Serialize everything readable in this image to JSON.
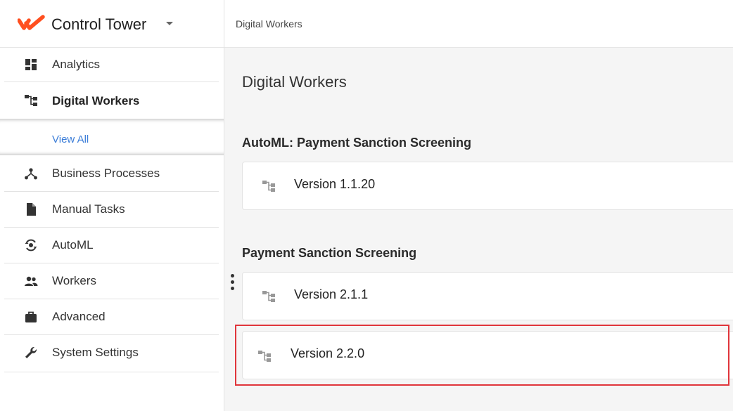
{
  "app": {
    "title": "Control Tower"
  },
  "breadcrumb": {
    "current": "Digital Workers"
  },
  "sidebar": {
    "items": [
      {
        "label": "Analytics",
        "icon": "dashboard-icon"
      },
      {
        "label": "Digital Workers",
        "icon": "hierarchy-icon",
        "active": true
      },
      {
        "label": "Business Processes",
        "icon": "process-icon"
      },
      {
        "label": "Manual Tasks",
        "icon": "document-icon"
      },
      {
        "label": "AutoML",
        "icon": "automl-icon"
      },
      {
        "label": "Workers",
        "icon": "people-icon"
      },
      {
        "label": "Advanced",
        "icon": "briefcase-icon"
      },
      {
        "label": "System Settings",
        "icon": "wrench-icon"
      }
    ],
    "subnav": {
      "view_all": "View All"
    }
  },
  "main": {
    "page_title": "Digital Workers",
    "groups": [
      {
        "title": "AutoML: Payment Sanction Screening",
        "versions": [
          "Version 1.1.20"
        ]
      },
      {
        "title": "Payment Sanction Screening",
        "versions": [
          "Version 2.1.1",
          "Version 2.2.0"
        ]
      }
    ]
  },
  "colors": {
    "brand": "#ff4f1f",
    "link": "#3b7dd8",
    "highlight": "#e0353b"
  }
}
